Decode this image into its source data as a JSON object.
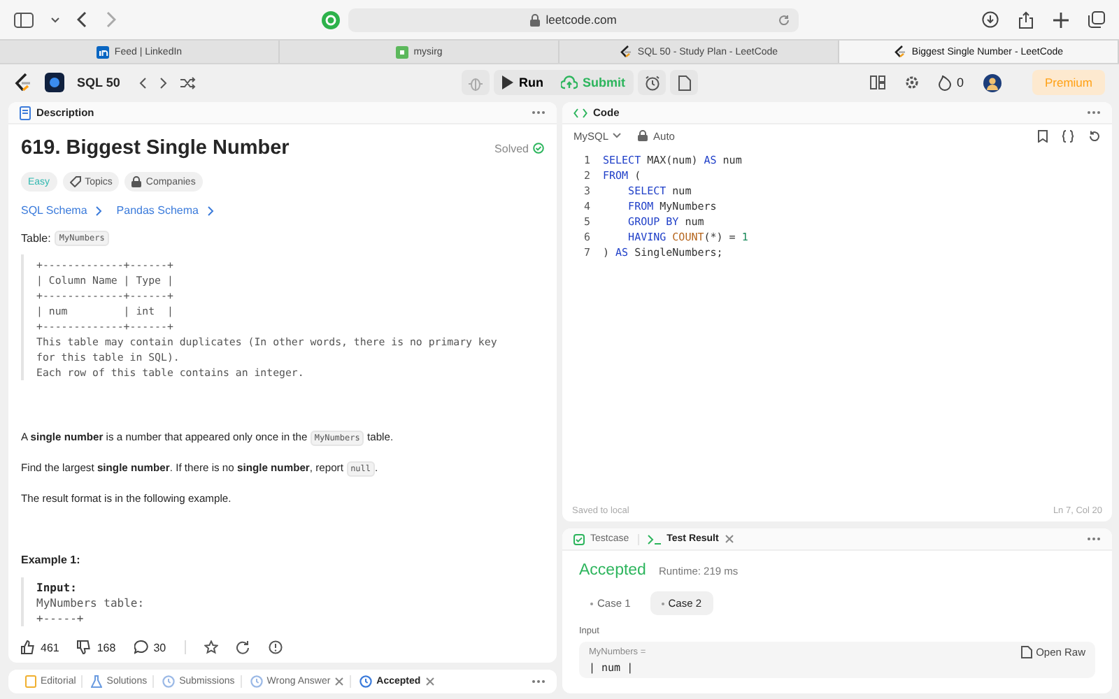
{
  "browser": {
    "url": "leetcode.com",
    "tabs": [
      {
        "title": "Feed | LinkedIn",
        "kind": "linkedin",
        "selected": false
      },
      {
        "title": "mysirg",
        "kind": "site",
        "selected": false
      },
      {
        "title": "SQL 50 - Study Plan - LeetCode",
        "kind": "leetcode",
        "selected": false
      },
      {
        "title": "Biggest Single Number - LeetCode",
        "kind": "leetcode",
        "selected": true
      }
    ]
  },
  "header": {
    "list_title": "SQL 50",
    "run": "Run",
    "submit": "Submit",
    "streak": "0",
    "premium": "Premium"
  },
  "description": {
    "tab": "Description",
    "title": "619. Biggest Single Number",
    "status": "Solved",
    "difficulty": "Easy",
    "tags": [
      "Topics",
      "Companies"
    ],
    "schema_links": [
      "SQL Schema",
      "Pandas Schema"
    ],
    "table_label": "Table:",
    "table_name": "MyNumbers",
    "schema_lines": [
      "+-------------+------+",
      "| Column Name | Type |",
      "+-------------+------+",
      "| num         | int  |",
      "+-------------+------+",
      "This table may contain duplicates (In other words, there is no primary key",
      "for this table in SQL).",
      "Each row of this table contains an integer."
    ],
    "paragraphs": [
      [
        {
          "kind": "text",
          "text": "A **single number** is a number that appeared only once in the "
        },
        {
          "kind": "code",
          "text": "MyNumbers"
        },
        {
          "kind": "text",
          "text": " table."
        }
      ],
      [
        {
          "kind": "text",
          "text": "Find the largest **single number**. If there is no **single number**, report "
        },
        {
          "kind": "code",
          "text": "null"
        },
        {
          "kind": "text",
          "text": "."
        }
      ],
      [
        {
          "kind": "text",
          "text": "The result format is in the following example."
        }
      ]
    ],
    "example_title": "Example 1:",
    "example_input_label": "Input:",
    "example_lines": [
      "MyNumbers table:",
      "+-----+"
    ],
    "likes": "461",
    "dislikes": "168",
    "comments": "30"
  },
  "bottom_tabs": [
    {
      "label": "Editorial",
      "kind": "editorial",
      "closable": false,
      "selected": false
    },
    {
      "label": "Solutions",
      "kind": "solutions",
      "closable": false,
      "selected": false
    },
    {
      "label": "Submissions",
      "kind": "clock",
      "closable": false,
      "selected": false
    },
    {
      "label": "Wrong Answer",
      "kind": "clock",
      "closable": true,
      "selected": false
    },
    {
      "label": "Accepted",
      "kind": "clock",
      "closable": true,
      "selected": true
    }
  ],
  "code": {
    "tab": "Code",
    "language": "MySQL",
    "mode": "Auto",
    "lines": [
      [
        {
          "kind": "kw",
          "text": "SELECT"
        },
        {
          "kind": "plain",
          "text": " MAX(num) "
        },
        {
          "kind": "kw",
          "text": "AS"
        },
        {
          "kind": "plain",
          "text": " num"
        }
      ],
      [
        {
          "kind": "kw",
          "text": "FROM"
        },
        {
          "kind": "plain",
          "text": " ("
        }
      ],
      [
        {
          "kind": "kw",
          "text": "    SELECT"
        },
        {
          "kind": "plain",
          "text": " num"
        }
      ],
      [
        {
          "kind": "kw",
          "text": "    FROM"
        },
        {
          "kind": "plain",
          "text": " MyNumbers"
        }
      ],
      [
        {
          "kind": "kw",
          "text": "    GROUP BY"
        },
        {
          "kind": "plain",
          "text": " num"
        }
      ],
      [
        {
          "kind": "kw",
          "text": "    HAVING"
        },
        {
          "kind": "fn",
          "text": " COUNT"
        },
        {
          "kind": "plain",
          "text": "(*) = "
        },
        {
          "kind": "num",
          "text": "1"
        }
      ],
      [
        {
          "kind": "plain",
          "text": ") "
        },
        {
          "kind": "kw",
          "text": "AS"
        },
        {
          "kind": "plain",
          "text": " SingleNumbers;"
        }
      ]
    ],
    "line_numbers": [
      "1",
      "2",
      "3",
      "4",
      "5",
      "6",
      "7"
    ],
    "saved": "Saved to local",
    "cursor": "Ln 7, Col 20"
  },
  "result": {
    "tabs": [
      {
        "label": "Testcase",
        "kind": "check",
        "selected": false,
        "closable": false
      },
      {
        "label": "Test Result",
        "kind": "terminal",
        "selected": true,
        "closable": true
      }
    ],
    "verdict": "Accepted",
    "runtime": "Runtime: 219 ms",
    "cases": [
      {
        "label": "Case 1",
        "selected": false
      },
      {
        "label": "Case 2",
        "selected": true
      }
    ],
    "input_label": "Input",
    "var_name": "MyNumbers =",
    "open_raw": "Open Raw",
    "value_line": "| num |"
  }
}
